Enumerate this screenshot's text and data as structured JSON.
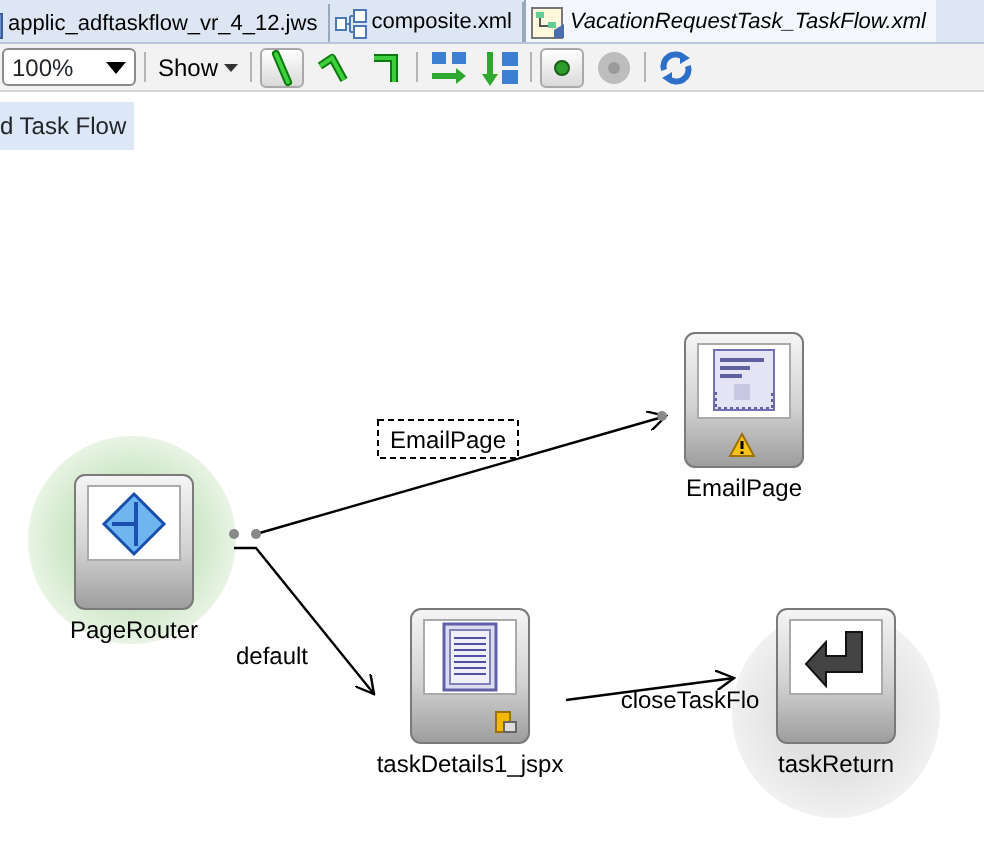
{
  "tabs": [
    {
      "label": "applic_adftaskflow_vr_4_12.jws",
      "kind": "workspace",
      "selected": false
    },
    {
      "label": "composite.xml",
      "kind": "composite",
      "selected": false
    },
    {
      "label": "VacationRequestTask_TaskFlow.xml",
      "kind": "taskflow",
      "selected": true
    }
  ],
  "toolbar": {
    "zoom": "100%",
    "show_menu": "Show",
    "buttons": [
      {
        "kind": "line-straight",
        "pressed": true
      },
      {
        "kind": "line-bent",
        "pressed": false
      },
      {
        "kind": "line-elbow",
        "pressed": false
      },
      {
        "kind": "layout-horizontal",
        "pressed": false
      },
      {
        "kind": "layout-vertical",
        "pressed": false
      },
      {
        "kind": "dot-green",
        "pressed": true
      },
      {
        "kind": "dot-gray",
        "pressed": false
      },
      {
        "kind": "refresh",
        "pressed": false
      }
    ]
  },
  "diagram": {
    "title": "d Task Flow",
    "nodes": [
      {
        "kind": "router",
        "label": "PageRouter",
        "default_activity": true,
        "warning": false,
        "page_definition": false
      },
      {
        "kind": "view",
        "label": "EmailPage",
        "default_activity": false,
        "warning": true,
        "page_definition": false
      },
      {
        "kind": "document",
        "label": "taskDetails1_jspx",
        "default_activity": false,
        "warning": false,
        "page_definition": true
      },
      {
        "kind": "return",
        "label": "taskReturn",
        "default_activity": false,
        "warning": false,
        "page_definition": false
      }
    ],
    "edges": [
      {
        "label": "EmailPage",
        "kind": "boxed"
      },
      {
        "label": "default",
        "kind": "plain"
      },
      {
        "label": "closeTaskFlo",
        "kind": "plain"
      }
    ]
  }
}
